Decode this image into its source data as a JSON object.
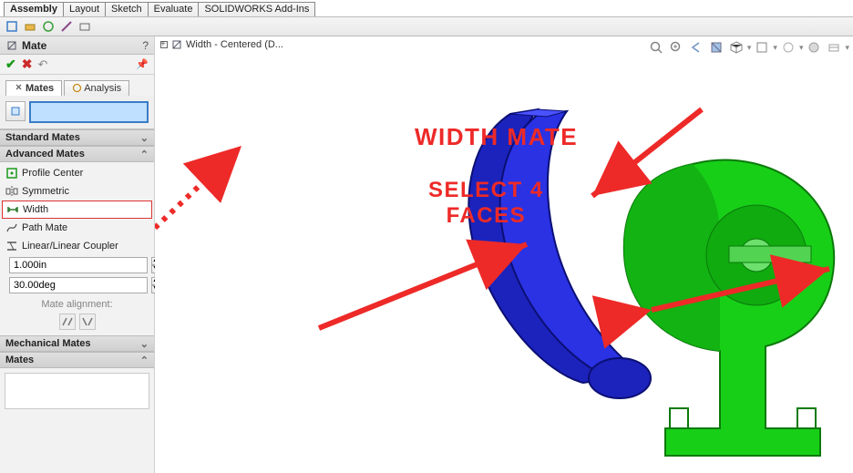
{
  "command_tabs": [
    "Assembly",
    "Layout",
    "Sketch",
    "Evaluate",
    "SOLIDWORKS Add-Ins"
  ],
  "active_command_tab": "Assembly",
  "panel": {
    "title": "Mate",
    "help_glyph": "?",
    "inner_tabs": {
      "mates": "Mates",
      "analysis": "Analysis"
    }
  },
  "sections": {
    "standard": "Standard Mates",
    "advanced": "Advanced Mates",
    "mechanical": "Mechanical Mates",
    "list": "Mates"
  },
  "advanced_mates": {
    "profile_center": "Profile Center",
    "symmetric": "Symmetric",
    "width": "Width",
    "path_mate": "Path Mate",
    "linear_coupler": "Linear/Linear Coupler"
  },
  "values": {
    "distance": "1.000in",
    "angle": "30.00deg"
  },
  "alignment_label": "Mate alignment:",
  "breadcrumb": "Width - Centered  (D...",
  "annotations": {
    "line1": "WIDTH MATE",
    "line2a": "SELECT 4",
    "line2b": "FACES"
  },
  "colors": {
    "accent_red": "#ed2a28",
    "part_blue": "#1c23bc",
    "part_green": "#18cf18",
    "sel_blue": "#3a7cc7"
  }
}
